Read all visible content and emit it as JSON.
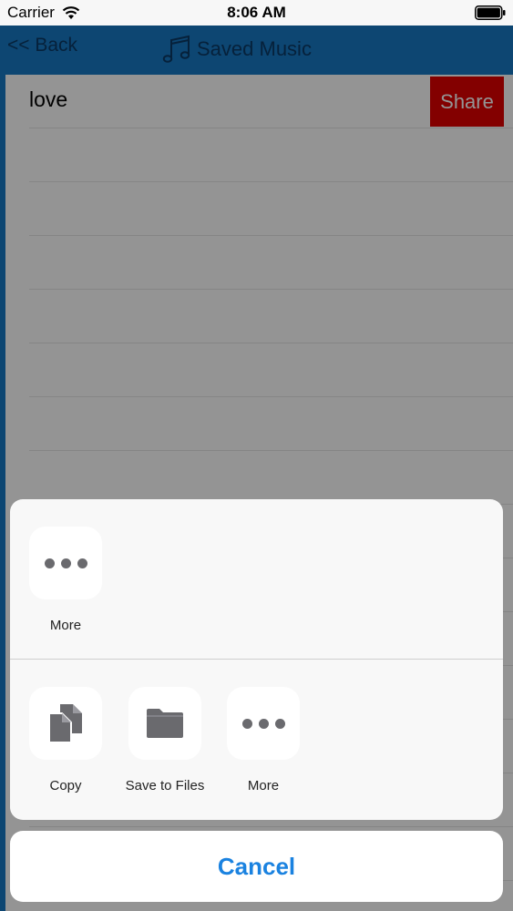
{
  "status_bar": {
    "carrier": "Carrier",
    "time": "8:06 AM"
  },
  "nav": {
    "back_label": "<< Back",
    "title": "Saved Music"
  },
  "list": {
    "items": [
      {
        "title": "love",
        "share_label": "Share"
      }
    ]
  },
  "share_sheet": {
    "top_row": [
      {
        "label": "More",
        "icon": "more-icon"
      }
    ],
    "bottom_row": [
      {
        "label": "Copy",
        "icon": "copy-icon"
      },
      {
        "label": "Save to Files",
        "icon": "folder-icon"
      },
      {
        "label": "More",
        "icon": "more-icon"
      }
    ],
    "cancel_label": "Cancel"
  },
  "colors": {
    "nav_bg": "#1779c4",
    "share_btn": "#e20000",
    "accent_blue": "#1a82e0"
  }
}
